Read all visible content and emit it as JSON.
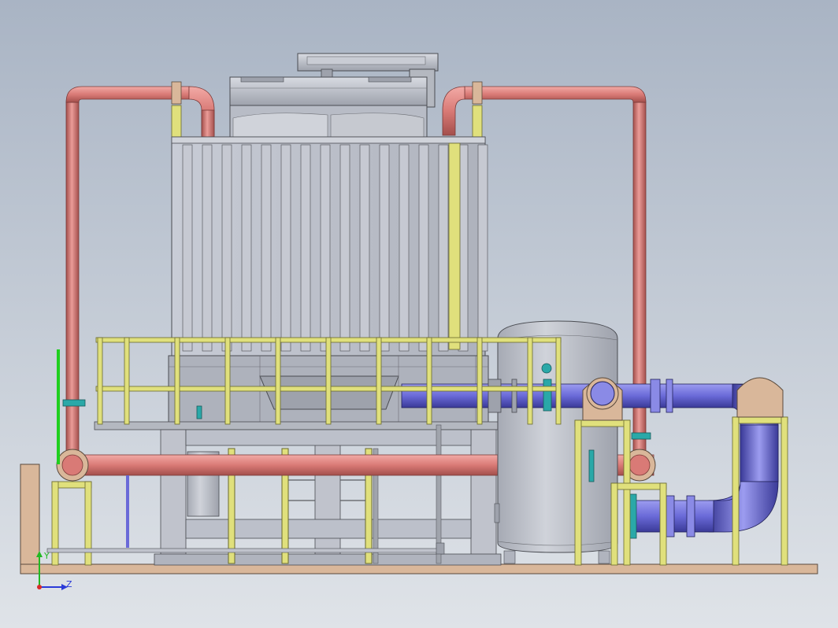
{
  "viewport": {
    "background_top": "#a9b4c4",
    "background_bottom": "#dfe3e8"
  },
  "colors": {
    "hot_pipe": "#d97a76",
    "hot_pipe_dark": "#a44f4c",
    "cold_pipe": "#6a6ad8",
    "cold_pipe_dark": "#3a3a98",
    "tower_body": "#bcc0ca",
    "tower_dark": "#8c909a",
    "railing": "#e0e07c",
    "railing_dark": "#8a8a3c",
    "support_frame": "#e0e07c",
    "base_plate": "#d9b79a",
    "flange": "#d9b79a",
    "valve": "#2aa8a8",
    "green_rod": "#1fcf1f"
  },
  "triad": {
    "y_label": "Y",
    "z_label": "Z",
    "y_color": "#22b822",
    "z_color": "#2a3ad8",
    "origin_color": "#d82a2a"
  }
}
